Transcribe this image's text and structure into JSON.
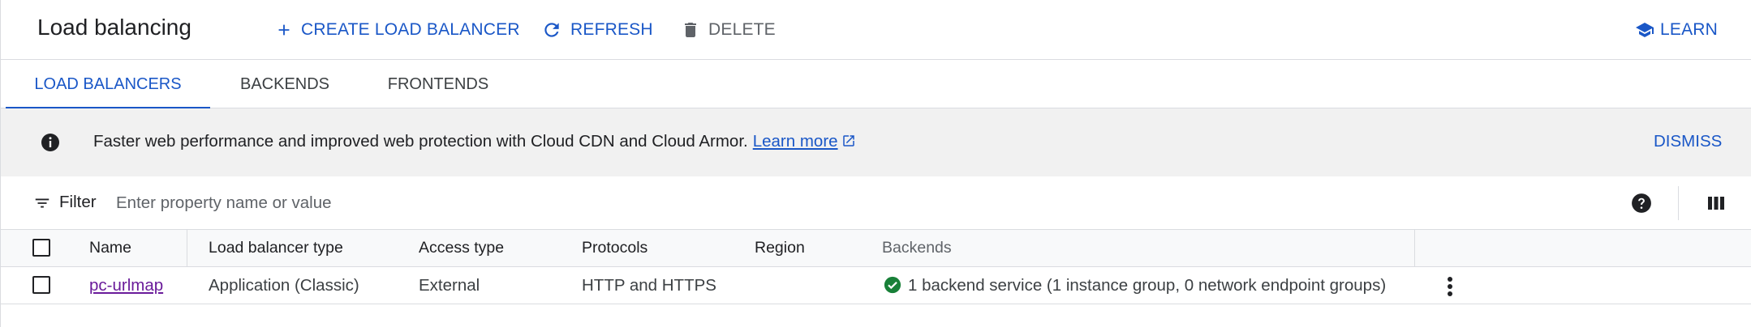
{
  "header": {
    "title": "Load balancing",
    "create_label": "CREATE LOAD BALANCER",
    "refresh_label": "REFRESH",
    "delete_label": "DELETE",
    "learn_label": "LEARN"
  },
  "tabs": [
    {
      "label": "LOAD BALANCERS",
      "active": true
    },
    {
      "label": "BACKENDS",
      "active": false
    },
    {
      "label": "FRONTENDS",
      "active": false
    }
  ],
  "banner": {
    "text": "Faster web performance and improved web protection with Cloud CDN and Cloud Armor.",
    "link": "Learn more",
    "dismiss": "DISMISS"
  },
  "filter": {
    "label": "Filter",
    "placeholder": "Enter property name or value"
  },
  "table": {
    "columns": [
      "Name",
      "Load balancer type",
      "Access type",
      "Protocols",
      "Region",
      "Backends"
    ],
    "rows": [
      {
        "name": "pc-urlmap",
        "type": "Application (Classic)",
        "access": "External",
        "protocols": "HTTP and HTTPS",
        "region": "",
        "backends": "1 backend service (1 instance group, 0 network endpoint groups)",
        "backends_status": "ok"
      }
    ]
  },
  "icons": {
    "create": "plus-icon",
    "refresh": "refresh-icon",
    "delete": "trash-icon",
    "learn": "school-icon",
    "info": "info-icon",
    "external": "open-in-new-icon",
    "filter": "filter-list-icon",
    "help": "help-icon",
    "columns": "column-display-icon",
    "status": "check-circle-icon",
    "more": "more-vert-icon"
  },
  "colors": {
    "accent": "#1a57c7",
    "link_visited": "#6a1b9a",
    "success": "#188038",
    "banner_bg": "#f1f1f1"
  }
}
